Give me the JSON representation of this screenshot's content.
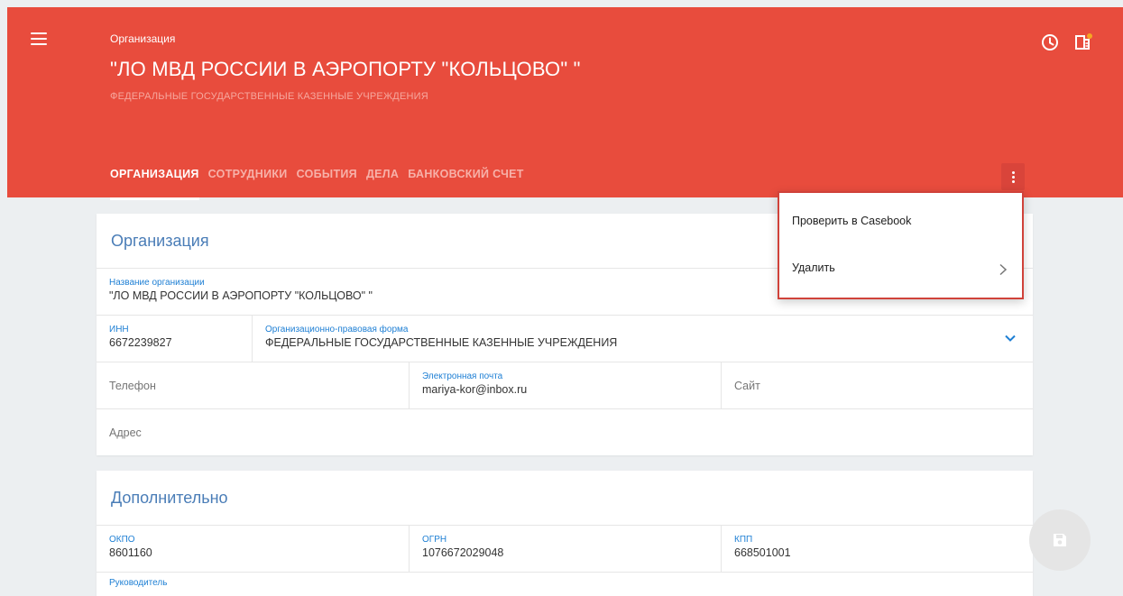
{
  "header": {
    "entity_label": "Организация",
    "title": "\"ЛО МВД РОССИИ В АЭРОПОРТУ \"КОЛЬЦОВО\" \"",
    "subtitle": "ФЕДЕРАЛЬНЫЕ ГОСУДАРСТВЕННЫЕ КАЗЕННЫЕ УЧРЕЖДЕНИЯ",
    "icons": [
      "menu-icon",
      "clock-icon",
      "bookmark-icon"
    ],
    "notification_dot_color": "#f5a623"
  },
  "tabs": [
    {
      "label": "ОРГАНИЗАЦИЯ",
      "active": true
    },
    {
      "label": "СОТРУДНИКИ",
      "active": false
    },
    {
      "label": "СОБЫТИЯ",
      "active": false
    },
    {
      "label": "ДЕЛА",
      "active": false
    },
    {
      "label": "БАНКОВСКИЙ СЧЕТ",
      "active": false
    }
  ],
  "menu": {
    "items": [
      {
        "label": "Проверить в Casebook"
      },
      {
        "label": "Удалить",
        "has_submenu": true
      }
    ]
  },
  "org_card": {
    "title": "Организация",
    "name_label": "Название организации",
    "name_value": "\"ЛО МВД  РОССИИ В АЭРОПОРТУ \"КОЛЬЦОВО\" \"",
    "inn_label": "ИНН",
    "inn_value": "6672239827",
    "legal_form_label": "Организационно-правовая форма",
    "legal_form_value": "ФЕДЕРАЛЬНЫЕ ГОСУДАРСТВЕННЫЕ КАЗЕННЫЕ УЧРЕЖДЕНИЯ",
    "phone_placeholder": "Телефон",
    "email_label": "Электронная почта",
    "email_value": "mariya-kor@inbox.ru",
    "site_placeholder": "Сайт",
    "address_placeholder": "Адрес"
  },
  "extra_card": {
    "title": "Дополнительно",
    "okpo_label": "ОКПО",
    "okpo_value": "8601160",
    "ogrn_label": "ОГРН",
    "ogrn_value": "1076672029048",
    "kpp_label": "КПП",
    "kpp_value": "668501001",
    "director_label": "Руководитель"
  },
  "colors": {
    "header_bg": "#e84c3d",
    "accent_blue": "#4a7db7",
    "field_label_blue": "#1e7fd4",
    "menu_highlight": "#d0423a"
  }
}
